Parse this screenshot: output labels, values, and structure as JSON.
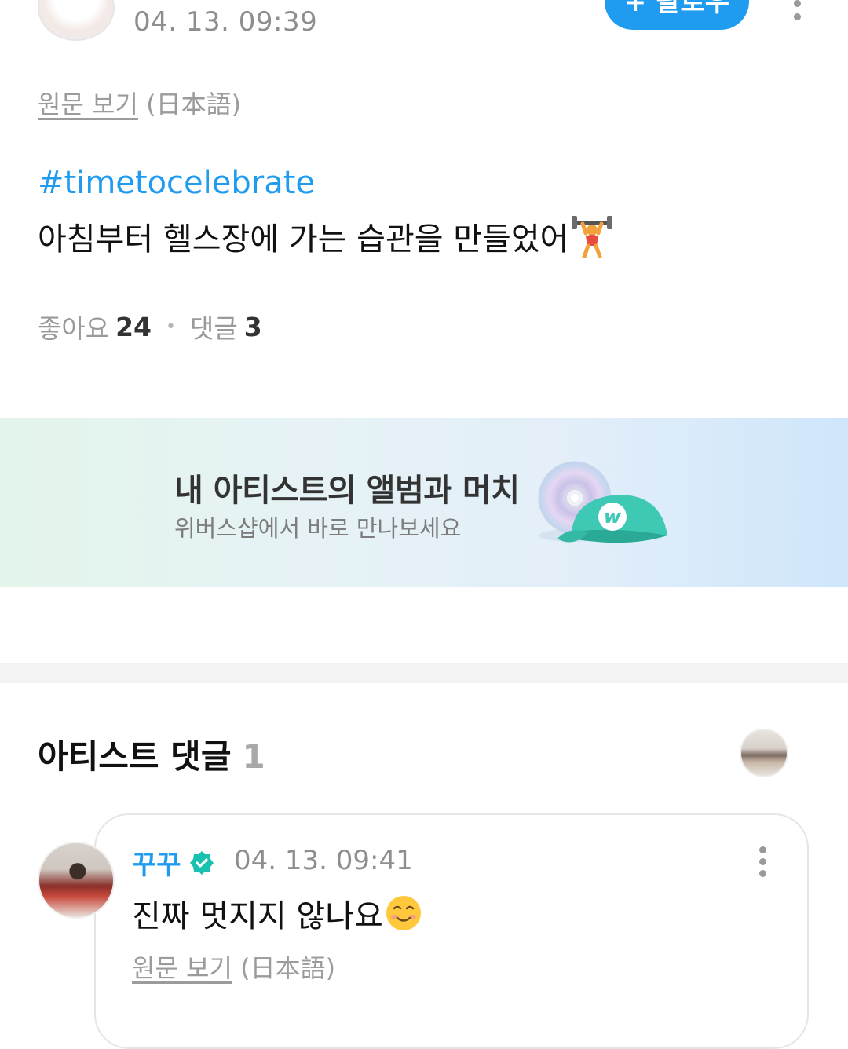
{
  "post": {
    "timestamp": "04. 13. 09:39",
    "follow_label": "+ 팔로우",
    "view_original": "원문 보기",
    "original_language": "(日本語)",
    "hashtag": "#timetocelebrate",
    "body": "아침부터 헬스장에 가는 습관을 만들었어",
    "body_emoji": "weightlifter-icon",
    "likes_label": "좋아요",
    "likes_count": "24",
    "comments_label": "댓글",
    "comments_count": "3"
  },
  "banner": {
    "title": "내 아티스트의 앨범과 머치",
    "subtitle": "위버스샵에서 바로 만나보세요"
  },
  "artist_comments": {
    "title": "아티스트 댓글",
    "count": "1",
    "comment": {
      "author": "꾸꾸",
      "timestamp": "04. 13. 09:41",
      "body": "진짜 멋지지 않나요",
      "body_emoji": "smiling-face-icon",
      "view_original": "원문 보기",
      "original_language": "(日本語)"
    }
  },
  "colors": {
    "accent": "#1f9bf0",
    "muted_text": "#9a9a9a"
  }
}
